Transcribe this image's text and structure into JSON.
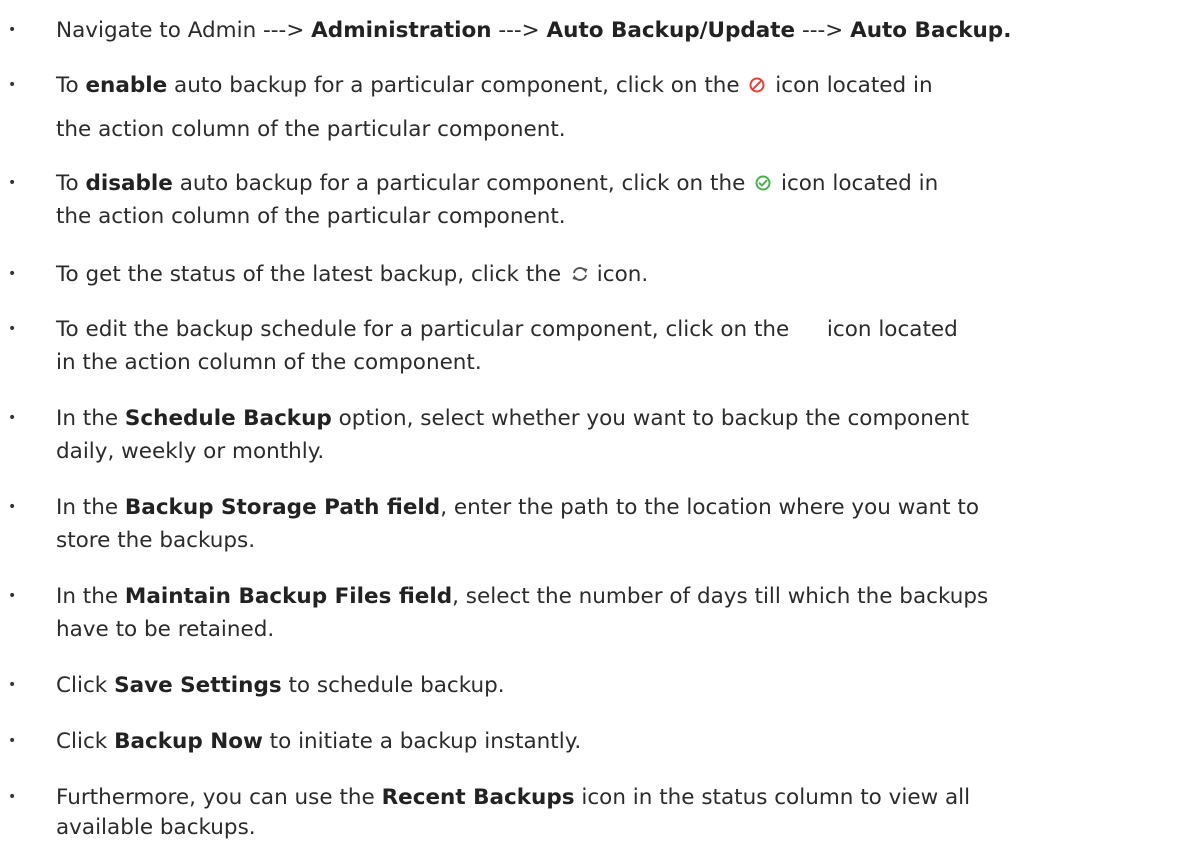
{
  "items": [
    {
      "id": "navigate",
      "parts": [
        "Navigate to Admin ---> ",
        "Administration",
        " ---> ",
        "Auto Backup/Update",
        " ---> ",
        "Auto Backup."
      ]
    },
    {
      "id": "enable",
      "parts": [
        "To ",
        "enable",
        " auto backup for a particular component, click on the ",
        " icon located in",
        "the action column of the particular component."
      ]
    },
    {
      "id": "disable",
      "parts": [
        "To ",
        "disable",
        " auto backup for a particular component, click on the ",
        " icon located in",
        "the action column of the particular component."
      ]
    },
    {
      "id": "status",
      "parts": [
        "To get the status of the latest backup, click the ",
        " icon."
      ]
    },
    {
      "id": "edit",
      "parts": [
        "To edit the backup schedule for a particular component, click on the ",
        " icon located",
        "in the action column of the component."
      ]
    },
    {
      "id": "schedule",
      "parts": [
        "In the ",
        "Schedule Backup",
        " option, select whether you want to backup the component",
        "daily, weekly or monthly."
      ]
    },
    {
      "id": "storage",
      "parts": [
        "In the ",
        "Backup Storage Path field",
        ", enter the path to the location where you want to",
        "store the backups."
      ]
    },
    {
      "id": "maintain",
      "parts": [
        "In the ",
        "Maintain Backup Files field",
        ", select the number of days till which the backups",
        "have to be retained."
      ]
    },
    {
      "id": "save",
      "parts": [
        "Click ",
        "Save Settings",
        " to schedule backup."
      ]
    },
    {
      "id": "backup-now",
      "parts": [
        "Click ",
        "Backup Now",
        " to initiate a backup instantly."
      ]
    },
    {
      "id": "recent",
      "parts": [
        "Furthermore, you can use the ",
        "Recent Backups",
        " icon in the status column to view all",
        "available backups."
      ]
    }
  ],
  "bullet": "•",
  "icons": {
    "disabled": {
      "name": "disabled-circle-icon",
      "color": "#e8413c"
    },
    "enabled": {
      "name": "enabled-check-circle-icon",
      "color": "#4caf50"
    },
    "refresh": {
      "name": "refresh-icon",
      "color": "#555555"
    }
  }
}
